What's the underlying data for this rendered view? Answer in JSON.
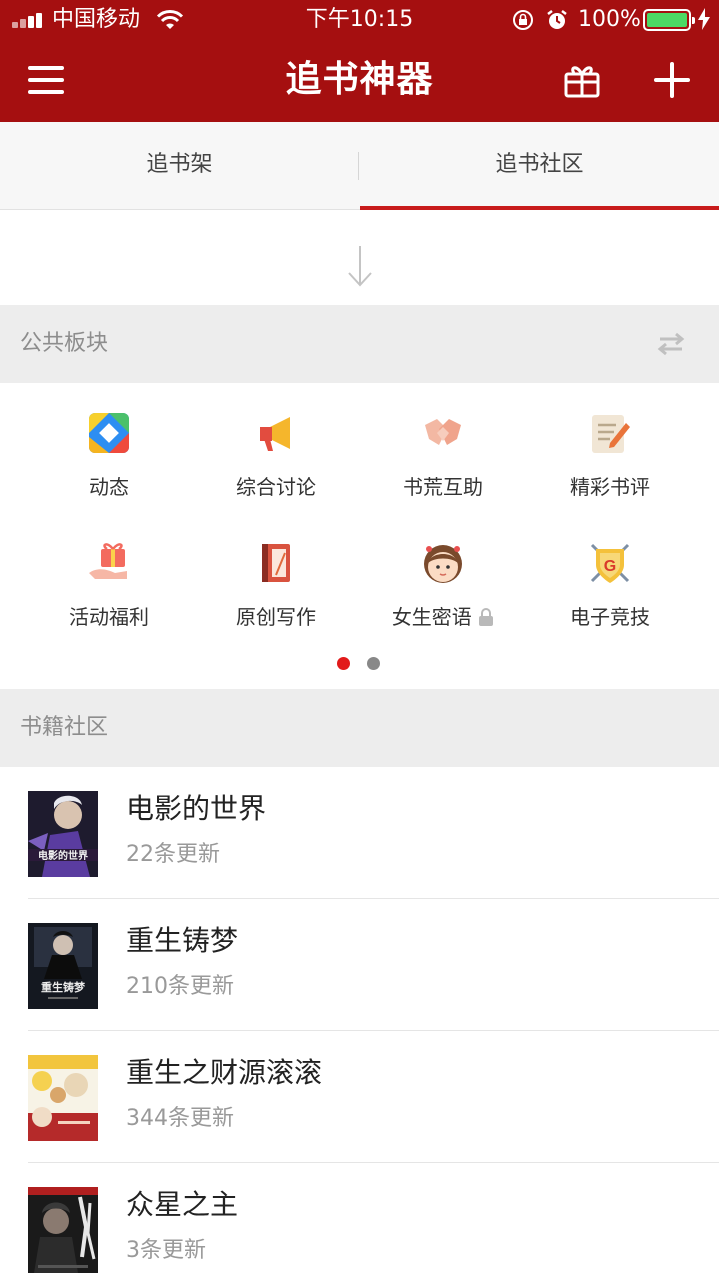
{
  "status_bar": {
    "carrier": "中国移动",
    "time": "下午10:15",
    "battery": "100%"
  },
  "nav": {
    "title": "追书神器"
  },
  "tabs": [
    {
      "label": "追书架",
      "selected": false
    },
    {
      "label": "追书社区",
      "selected": true
    }
  ],
  "public_section": {
    "title": "公共板块",
    "items": [
      {
        "label": "动态",
        "icon": "dynamic-icon"
      },
      {
        "label": "综合讨论",
        "icon": "megaphone-icon"
      },
      {
        "label": "书荒互助",
        "icon": "handshake-icon"
      },
      {
        "label": "精彩书评",
        "icon": "review-icon"
      },
      {
        "label": "活动福利",
        "icon": "gift-hand-icon"
      },
      {
        "label": "原创写作",
        "icon": "book-quill-icon"
      },
      {
        "label": "女生密语",
        "icon": "girl-face-icon"
      },
      {
        "label": "电子竞技",
        "icon": "esports-shield-icon"
      }
    ],
    "page": 1,
    "page_count": 2
  },
  "book_section": {
    "title": "书籍社区",
    "books": [
      {
        "title": "电影的世界",
        "updates": "22条更新"
      },
      {
        "title": "重生铸梦",
        "updates": "210条更新"
      },
      {
        "title": "重生之财源滚滚",
        "updates": "344条更新"
      },
      {
        "title": "众星之主",
        "updates": "3条更新"
      }
    ]
  },
  "colors": {
    "brand": "#a50f10",
    "tab_indicator": "#c81b1b",
    "active_dot": "#e21a1a"
  }
}
